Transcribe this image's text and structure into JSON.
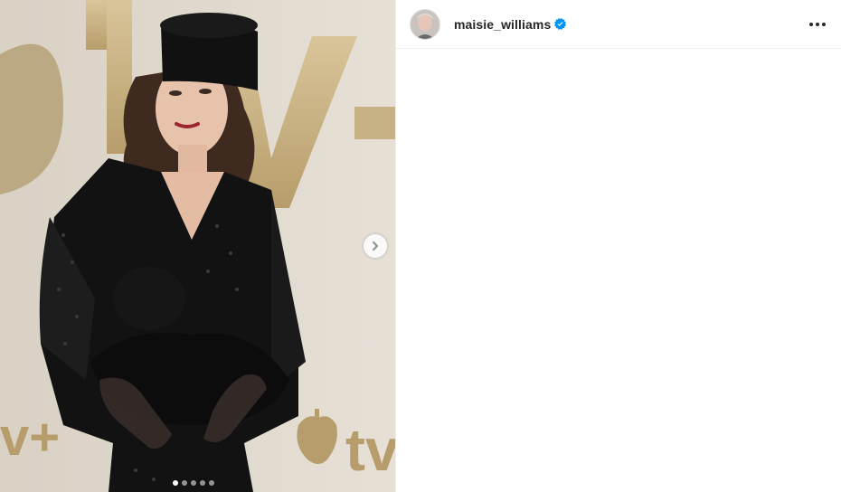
{
  "post": {
    "carousel": {
      "slide_count": 5,
      "active_index": 0,
      "next_icon": "chevron-right-icon"
    },
    "header": {
      "username": "maisie_williams",
      "verified": true,
      "verified_icon": "verified-badge-icon",
      "more_icon": "more-horizontal-icon"
    }
  },
  "colors": {
    "verified_blue": "#0095f6",
    "text": "#262626",
    "divider": "#efefef"
  }
}
